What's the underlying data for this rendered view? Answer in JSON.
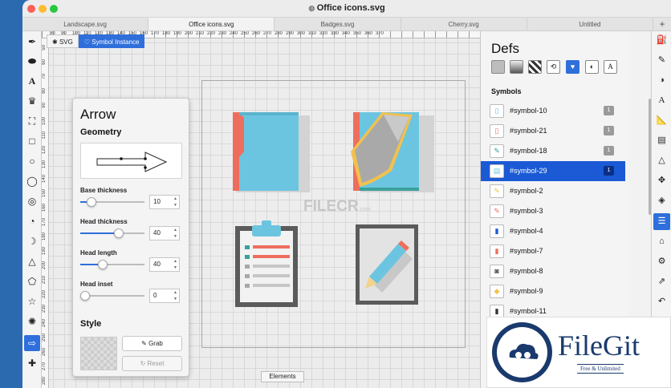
{
  "window": {
    "title": "Office icons.svg"
  },
  "tabs": [
    {
      "label": "Landscape.svg"
    },
    {
      "label": "Office icons.svg"
    },
    {
      "label": "Badges.svg"
    },
    {
      "label": "Cherry.svg"
    },
    {
      "label": "Untitled"
    }
  ],
  "add_tab": "+",
  "mode_bar": {
    "svg": "SVG",
    "symbol_instance": "Symbol Instance"
  },
  "ruler_top": [
    "80",
    "90",
    "100",
    "110",
    "120",
    "130",
    "140",
    "150",
    "160",
    "170",
    "180",
    "190",
    "200",
    "210",
    "220",
    "230",
    "240",
    "250",
    "260",
    "270",
    "280",
    "290",
    "300",
    "310",
    "320",
    "330",
    "340",
    "350",
    "360",
    "370"
  ],
  "ruler_left": [
    "50",
    "60",
    "70",
    "80",
    "90",
    "100",
    "110",
    "120",
    "130",
    "140",
    "150",
    "160",
    "170",
    "180",
    "190",
    "200",
    "210",
    "220",
    "230",
    "240",
    "250",
    "260",
    "270",
    "280"
  ],
  "inspector": {
    "title": "Arrow",
    "geometry": "Geometry",
    "fields": [
      {
        "label": "Base thickness",
        "value": "10",
        "fraction": 0.12
      },
      {
        "label": "Head thickness",
        "value": "40",
        "fraction": 0.62
      },
      {
        "label": "Head length",
        "value": "40",
        "fraction": 0.33
      },
      {
        "label": "Head inset",
        "value": "0",
        "fraction": 0.0
      }
    ],
    "style": "Style",
    "grab": "Grab",
    "reset": "Reset"
  },
  "elements_button": "Elements",
  "defs": {
    "title": "Defs",
    "icons": [
      "solid-fill-icon",
      "linear-gradient-icon",
      "pattern-icon",
      "transform-icon",
      "symbol-heart-icon",
      "mask-icon",
      "font-icon"
    ],
    "symbols_title": "Symbols",
    "symbols": [
      {
        "name": "#symbol-10",
        "count": "1",
        "selected": false
      },
      {
        "name": "#symbol-21",
        "count": "1",
        "selected": false
      },
      {
        "name": "#symbol-18",
        "count": "1",
        "selected": false
      },
      {
        "name": "#symbol-29",
        "count": "1",
        "selected": true
      },
      {
        "name": "#symbol-2",
        "count": "",
        "selected": false
      },
      {
        "name": "#symbol-3",
        "count": "",
        "selected": false
      },
      {
        "name": "#symbol-4",
        "count": "",
        "selected": false
      },
      {
        "name": "#symbol-7",
        "count": "",
        "selected": false
      },
      {
        "name": "#symbol-8",
        "count": "",
        "selected": false
      },
      {
        "name": "#symbol-9",
        "count": "",
        "selected": false
      },
      {
        "name": "#symbol-11",
        "count": "",
        "selected": false
      }
    ]
  },
  "watermark": {
    "text": "FILECR",
    "suffix": ".com"
  },
  "filegit": {
    "name": "FileGit",
    "tagline": "Free & Unlimited"
  },
  "colors": {
    "accent": "#2f6fdb",
    "selection": "#1b5ad4",
    "folder_blue": "#6cc5e0",
    "folder_red": "#ee6e5e",
    "badge": "#9a9a9a"
  }
}
